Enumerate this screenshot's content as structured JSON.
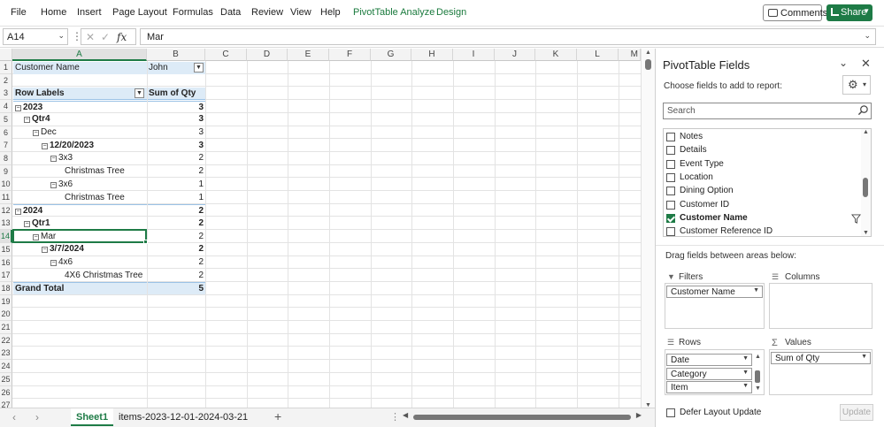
{
  "menu": [
    "File",
    "Home",
    "Insert",
    "Page Layout",
    "Formulas",
    "Data",
    "Review",
    "View",
    "Help",
    "PivotTable Analyze",
    "Design"
  ],
  "menu_active_color": "#1a7a3d",
  "toolbar": {
    "comments_label": "Comments",
    "share_label": "Share"
  },
  "formula_bar": {
    "name_box": "A14",
    "formula": "Mar",
    "fx": "fx"
  },
  "columns": [
    "A",
    "B",
    "C",
    "D",
    "E",
    "F",
    "G",
    "H",
    "I",
    "J",
    "K",
    "L",
    "M"
  ],
  "rows": [
    "1",
    "2",
    "3",
    "4",
    "5",
    "6",
    "7",
    "8",
    "9",
    "10",
    "11",
    "12",
    "13",
    "14",
    "15",
    "16",
    "17",
    "18",
    "19",
    "20",
    "21",
    "22",
    "23",
    "24",
    "25",
    "26",
    "27"
  ],
  "pivot": {
    "filter_label": "Customer Name",
    "filter_value": "John",
    "row_labels_header": "Row Labels",
    "value_header": "Sum of Qty",
    "rows": [
      {
        "label": "2023",
        "value": "3"
      },
      {
        "label": "Qtr4",
        "value": "3"
      },
      {
        "label": "Dec",
        "value": "3"
      },
      {
        "label": "12/20/2023",
        "value": "3"
      },
      {
        "label": "3x3",
        "value": "2"
      },
      {
        "label": "Christmas Tree",
        "value": "2"
      },
      {
        "label": "3x6",
        "value": "1"
      },
      {
        "label": "Christmas Tree",
        "value": "1"
      },
      {
        "label": "2024",
        "value": "2"
      },
      {
        "label": "Qtr1",
        "value": "2"
      },
      {
        "label": "Mar",
        "value": "2"
      },
      {
        "label": "3/7/2024",
        "value": "2"
      },
      {
        "label": "4x6",
        "value": "2"
      },
      {
        "label": "4X6 Christmas Tree",
        "value": "2"
      },
      {
        "label": "Grand Total",
        "value": "5"
      }
    ]
  },
  "sheets": {
    "active": "Sheet1",
    "other": "items-2023-12-01-2024-03-21",
    "add": "+"
  },
  "pane": {
    "title": "PivotTable Fields",
    "subtitle": "Choose fields to add to report:",
    "search_placeholder": "Search",
    "fields": [
      {
        "name": "Notes",
        "checked": false
      },
      {
        "name": "Details",
        "checked": false
      },
      {
        "name": "Event Type",
        "checked": false
      },
      {
        "name": "Location",
        "checked": false
      },
      {
        "name": "Dining Option",
        "checked": false
      },
      {
        "name": "Customer ID",
        "checked": false
      },
      {
        "name": "Customer Name",
        "checked": true
      },
      {
        "name": "Customer Reference ID",
        "checked": false
      }
    ],
    "drag_label": "Drag fields between areas below:",
    "areas": {
      "filters": {
        "title": "Filters",
        "items": [
          "Customer Name"
        ]
      },
      "columns": {
        "title": "Columns",
        "items": []
      },
      "rows": {
        "title": "Rows",
        "items": [
          "Date",
          "Category",
          "Item"
        ]
      },
      "values": {
        "title": "Values",
        "items": [
          "Sum of Qty"
        ]
      }
    },
    "defer_label": "Defer Layout Update",
    "update_label": "Update"
  }
}
